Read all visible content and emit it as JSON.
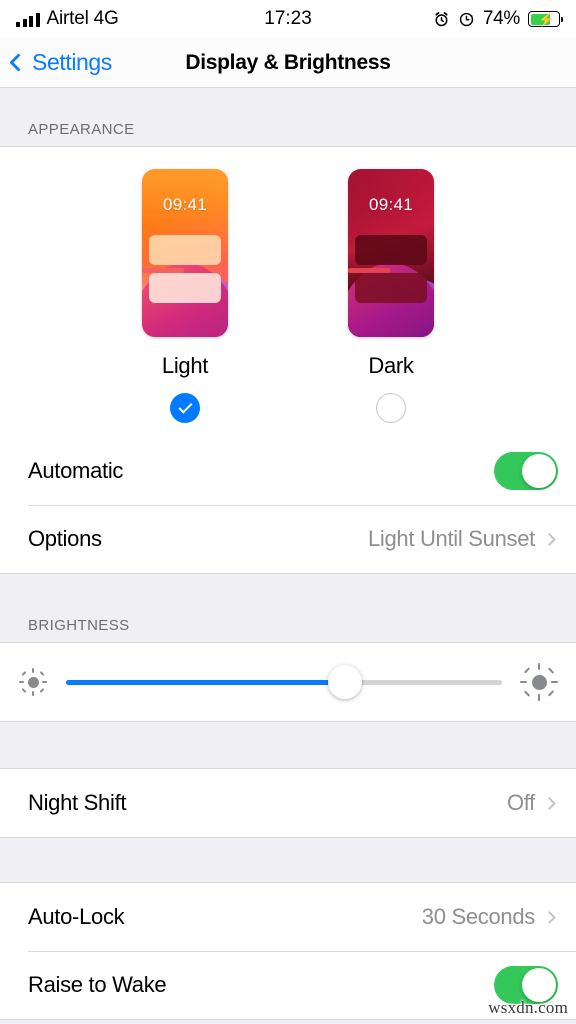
{
  "status_bar": {
    "carrier": "Airtel 4G",
    "signal_icon": "signal-bars-icon",
    "time": "17:23",
    "alarm_icon": "alarm-clock-icon",
    "rotation_lock_icon": "rotation-lock-icon",
    "battery_percent": "74%",
    "battery_level": 74,
    "battery_icon": "battery-charging-icon",
    "charging": true
  },
  "nav": {
    "back_label": "Settings",
    "back_icon": "chevron-left-icon",
    "title": "Display & Brightness"
  },
  "appearance": {
    "header": "APPEARANCE",
    "themes": [
      {
        "name": "Light",
        "time": "09:41",
        "selected": true
      },
      {
        "name": "Dark",
        "time": "09:41",
        "selected": false
      }
    ],
    "rows": [
      {
        "label": "Automatic",
        "type": "toggle",
        "value": "on"
      },
      {
        "label": "Options",
        "type": "disclosure",
        "value": "Light Until Sunset"
      }
    ]
  },
  "brightness": {
    "header": "BRIGHTNESS",
    "slider": {
      "value_percent": 64,
      "low_icon": "sun-dim-icon",
      "high_icon": "sun-bright-icon",
      "fill_color": "#0a7bff"
    }
  },
  "night_shift": {
    "rows": [
      {
        "label": "Night Shift",
        "type": "disclosure",
        "value": "Off"
      }
    ]
  },
  "display": {
    "rows": [
      {
        "label": "Auto-Lock",
        "type": "disclosure",
        "value": "30 Seconds"
      },
      {
        "label": "Raise to Wake",
        "type": "toggle",
        "value": "on"
      }
    ]
  },
  "watermark": "wsxdn.com",
  "colors": {
    "accent_blue": "#007aff",
    "link_blue": "#0a7bff",
    "toggle_green": "#34c759",
    "group_bg": "#efeff4",
    "secondary_text": "#8e8e93"
  }
}
